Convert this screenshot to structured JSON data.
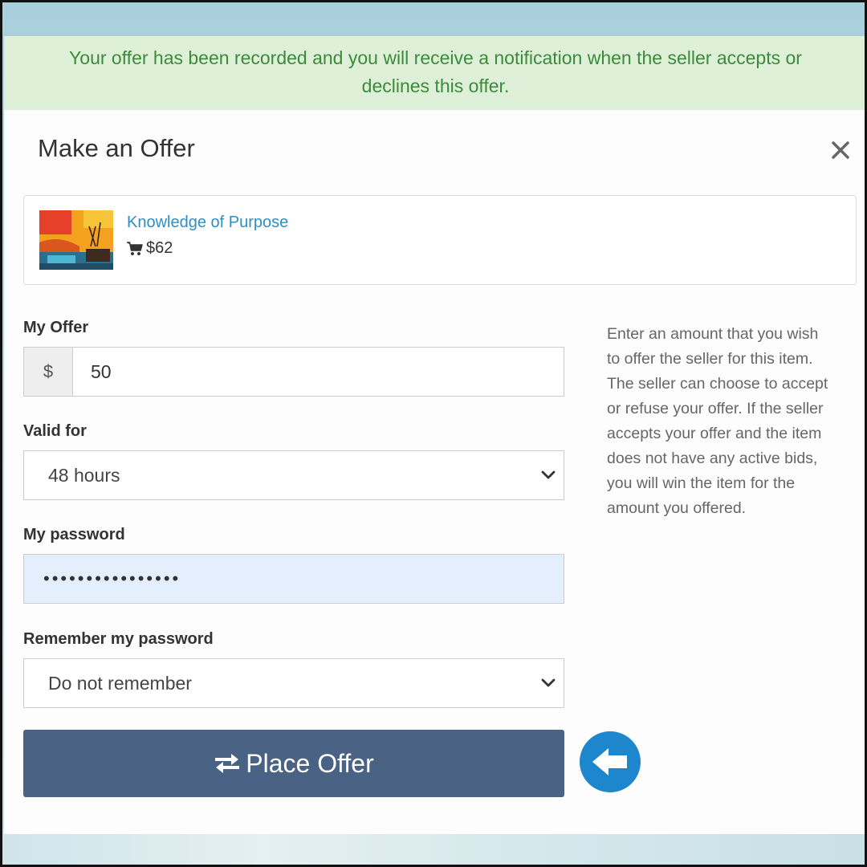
{
  "alert": {
    "line1": "Your offer has been recorded and you will receive a notification when the seller accepts or",
    "line2": "declines this offer."
  },
  "modal": {
    "title": "Make an Offer",
    "close_icon": "close-icon"
  },
  "item": {
    "title": "Knowledge of Purpose",
    "price": "$62",
    "price_icon": "shopping-cart-icon"
  },
  "form": {
    "offer_label": "My Offer",
    "currency_symbol": "$",
    "offer_value": "50",
    "valid_label": "Valid for",
    "valid_value": "48 hours",
    "password_label": "My password",
    "password_mask": "••••••••••••••••",
    "remember_label": "Remember my password",
    "remember_value": "Do not remember",
    "submit_label": "Place Offer",
    "submit_icon": "exchange-icon"
  },
  "help": {
    "lines": [
      "Enter an amount that you wish",
      "to offer the seller for this item.",
      "The seller can choose to accept",
      "or refuse your offer. If the seller",
      "accepts your offer and the item",
      "does not have any active bids,",
      "you will win the item for the",
      "amount you offered."
    ]
  },
  "annotation": {
    "icon": "arrow-left-icon",
    "color": "#1d86cc"
  },
  "colors": {
    "alert_bg": "#dff0d8",
    "alert_text": "#3c8a3c",
    "link": "#2f8fc4",
    "button": "#4a6384",
    "password_bg": "#e4effd"
  }
}
